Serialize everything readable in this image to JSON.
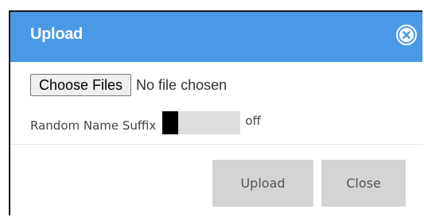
{
  "dialog": {
    "title": "Upload",
    "close_icon": "close-circle-icon"
  },
  "file_input": {
    "button_label": "Choose Files",
    "status_text": "No file chosen"
  },
  "random_suffix": {
    "label": "Random Name Suffix",
    "state": "off"
  },
  "footer": {
    "upload_label": "Upload",
    "close_label": "Close"
  },
  "colors": {
    "header": "#4a99e6",
    "button_bg": "#d4d4d4",
    "toggle_track": "#dddddd",
    "toggle_knob": "#000000"
  }
}
